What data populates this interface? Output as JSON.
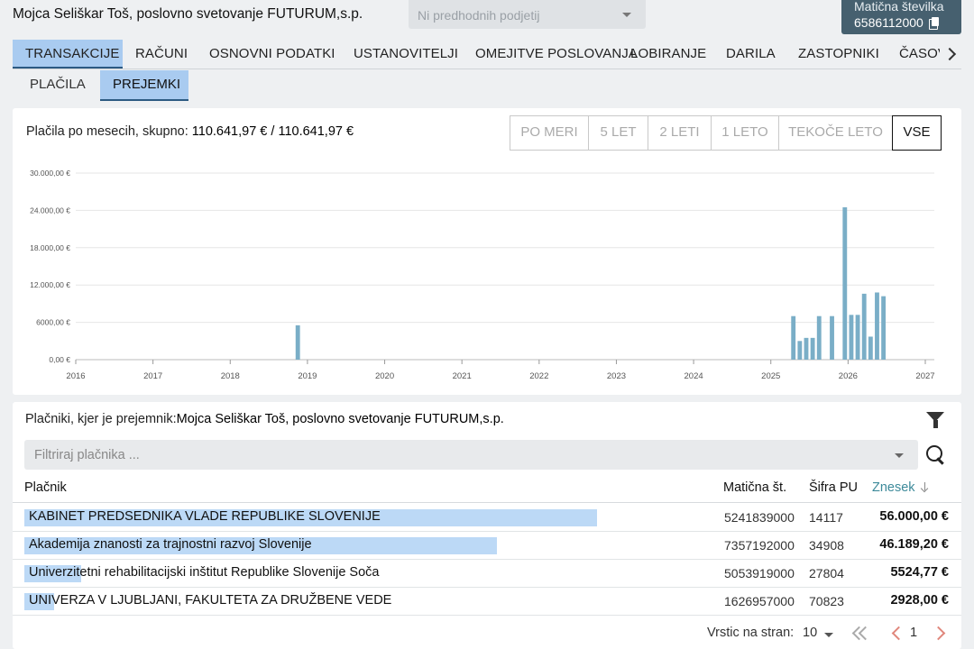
{
  "header": {
    "title": "Mojca Seliškar Toš, poslovno svetovanje FUTURUM,s.p.",
    "predecessor_placeholder": "Ni predhodnih podjetij",
    "registration_label": "Matična številka",
    "registration_number": "6586112000"
  },
  "main_tabs": [
    "TRANSAKCIJE",
    "RAČUNI",
    "OSNOVNI PODATKI",
    "USTANOVITELJI",
    "OMEJITVE POSLOVANJA",
    "LOBIRANJE",
    "DARILA",
    "ZASTOPNIKI",
    "ČASOVNIC"
  ],
  "sub_tabs": [
    "PLAČILA",
    "PREJEMKI"
  ],
  "summary": {
    "label": "Plačila po mesecih, skupno:",
    "value": "110.641,97 € / 110.641,97 €"
  },
  "range_buttons": [
    "PO MERI",
    "5 LET",
    "2 LETI",
    "1 LETO",
    "TEKOČE LETO",
    "VSE"
  ],
  "chart_data": {
    "type": "bar",
    "title": "",
    "xlabel": "",
    "ylabel": "",
    "y_ticks": [
      "0,00 €",
      "6000,00 €",
      "12.000,00 €",
      "18.000,00 €",
      "24.000,00 €",
      "30.000,00 €"
    ],
    "x_ticks": [
      "2016",
      "2017",
      "2018",
      "2019",
      "2020",
      "2021",
      "2022",
      "2023",
      "2024",
      "2025",
      "2026",
      "2027"
    ],
    "xlim": [
      "2016-01",
      "2027-01"
    ],
    "ylim": [
      0,
      30000
    ],
    "grid": true,
    "color": "#7aaec7",
    "series": [
      {
        "x": [
          "2018-11",
          "2025-04",
          "2025-05",
          "2025-06",
          "2025-07",
          "2025-08",
          "2025-10",
          "2025-12",
          "2026-01",
          "2026-02",
          "2026-03",
          "2026-04",
          "2026-05",
          "2026-06",
          "2026-07"
        ],
        "values": [
          5524.77,
          7000,
          3000,
          3500,
          3500,
          7000,
          7000,
          24500,
          7200,
          7200,
          10600,
          3700,
          10800,
          10200,
          0
        ]
      }
    ]
  },
  "payers": {
    "caption_label": "Plačniki, kjer je prejemnik:",
    "caption_value": "Mojca Seliškar Toš, poslovno svetovanje FUTURUM,s.p.",
    "filter_placeholder": "Filtriraj plačnika ...",
    "columns": [
      "Plačnik",
      "Matična št.",
      "Šifra PU",
      "Znesek"
    ],
    "rows": [
      {
        "name": "KABINET PREDSEDNIKA VLADE REPUBLIKE SLOVENIJE",
        "maticna": "5241839000",
        "sifra": "14117",
        "amount": "56.000,00 €",
        "share": 1.0
      },
      {
        "name": "Akademija znanosti za trajnostni razvoj Slovenije",
        "maticna": "7357192000",
        "sifra": "34908",
        "amount": "46.189,20 €",
        "share": 0.825
      },
      {
        "name": "Univerzitetni rehabilitacijski inštitut Republike Slovenije Soča",
        "maticna": "5053919000",
        "sifra": "27804",
        "amount": "5524,77 €",
        "share": 0.099
      },
      {
        "name": "UNIVERZA V LJUBLJANI, FAKULTETA ZA DRUŽBENE VEDE",
        "maticna": "1626957000",
        "sifra": "70823",
        "amount": "2928,00 €",
        "share": 0.052
      }
    ]
  },
  "pagination": {
    "rows_label": "Vrstic na stran:",
    "rows_per_page": "10",
    "current_page": "1"
  }
}
